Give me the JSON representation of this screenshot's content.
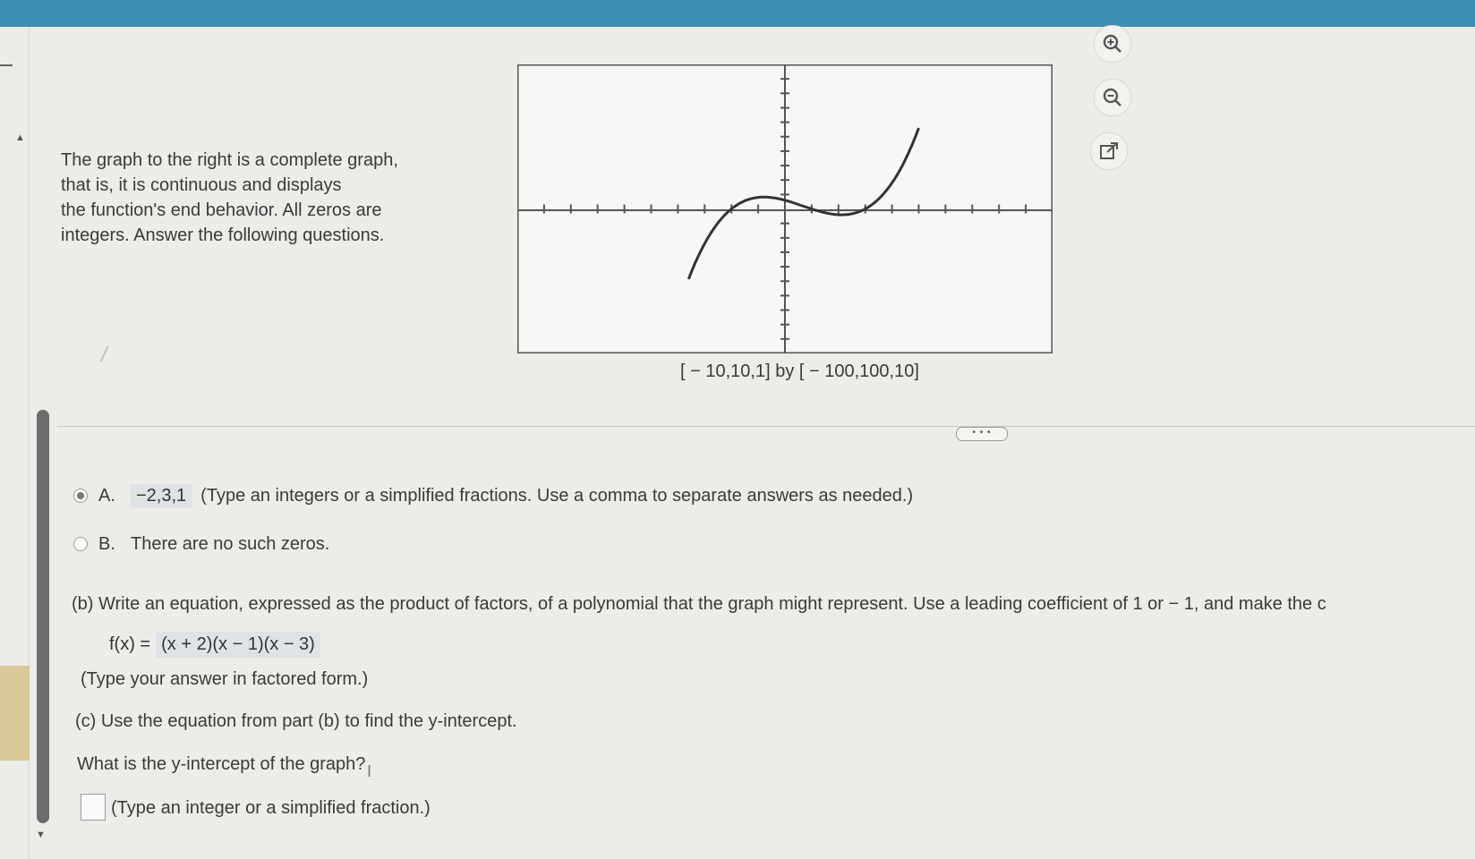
{
  "intro": {
    "lines": [
      "The graph to the right is a complete graph,",
      "that is, it is continuous and displays",
      "the function's end behavior. All zeros are",
      "integers. Answer the following questions."
    ]
  },
  "graph": {
    "window_caption": "[ − 10,10,1] by [ − 100,100,10]"
  },
  "toolbar": {
    "zoom_in_icon": "zoom-in-icon",
    "zoom_out_icon": "zoom-out-icon",
    "popout_icon": "external-link-icon",
    "more_label": "• • •"
  },
  "part_a": {
    "option_a": {
      "letter": "A.",
      "answer": "−2,3,1",
      "instruction": "(Type an integers or a simplified fractions. Use a comma to separate answers as needed.)",
      "selected": true
    },
    "option_b": {
      "letter": "B.",
      "text": "There are no such zeros.",
      "selected": false
    }
  },
  "part_b": {
    "prompt": "(b) Write an equation, expressed as the product of factors, of a polynomial that the graph might represent. Use a leading coefficient of 1 or − 1, and make the c",
    "eq_label": "f(x) =",
    "eq_answer": "(x + 2)(x − 1)(x − 3)",
    "note": "(Type your answer in factored form.)"
  },
  "part_c": {
    "prompt": "(c) Use the equation from part (b) to find the y-intercept.",
    "question": "What is the y-intercept of the graph?",
    "note": "(Type an integer or a simplified fraction.)"
  }
}
